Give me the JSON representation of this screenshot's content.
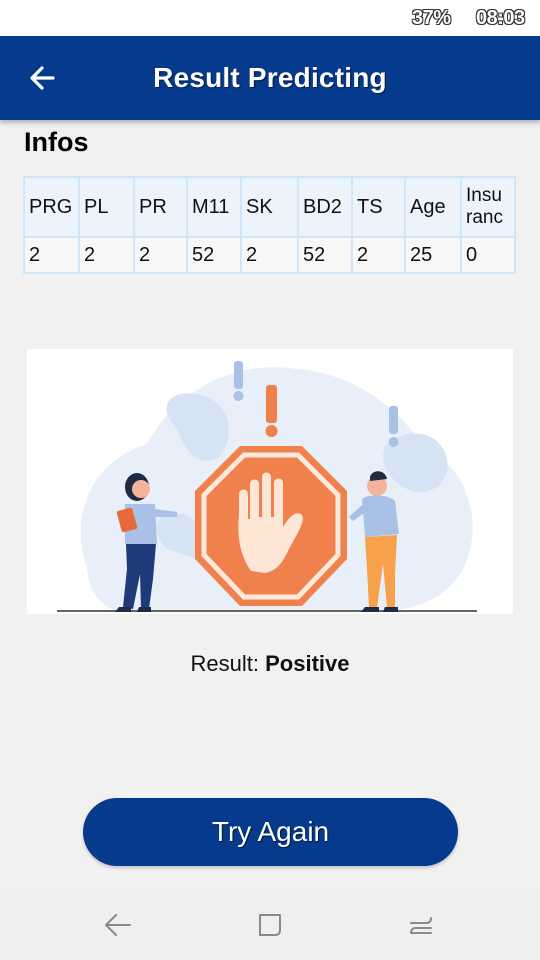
{
  "status_bar": {
    "battery": "37%",
    "time": "08:03"
  },
  "app_bar": {
    "title": "Result Predicting",
    "back_icon": "arrow-left-icon"
  },
  "infos": {
    "title": "Infos",
    "headers": [
      "PRG",
      "PL",
      "PR",
      "M11",
      "SK",
      "BD2",
      "TS",
      "Age",
      "Insu ranc"
    ],
    "values": [
      "2",
      "2",
      "2",
      "52",
      "2",
      "52",
      "2",
      "25",
      "0"
    ]
  },
  "illustration": {
    "description_icon": "stop-hand-sign-illustration"
  },
  "result": {
    "label": "Result:",
    "value": "Positive"
  },
  "try_again_button": {
    "label": "Try Again"
  },
  "nav_bar": {
    "back_icon": "nav-back-icon",
    "home_icon": "nav-home-icon",
    "recents_icon": "nav-recents-icon"
  },
  "colors": {
    "primary": "#063a8c",
    "table_border": "#cfe5fa",
    "stop_sign": "#f0814c"
  }
}
